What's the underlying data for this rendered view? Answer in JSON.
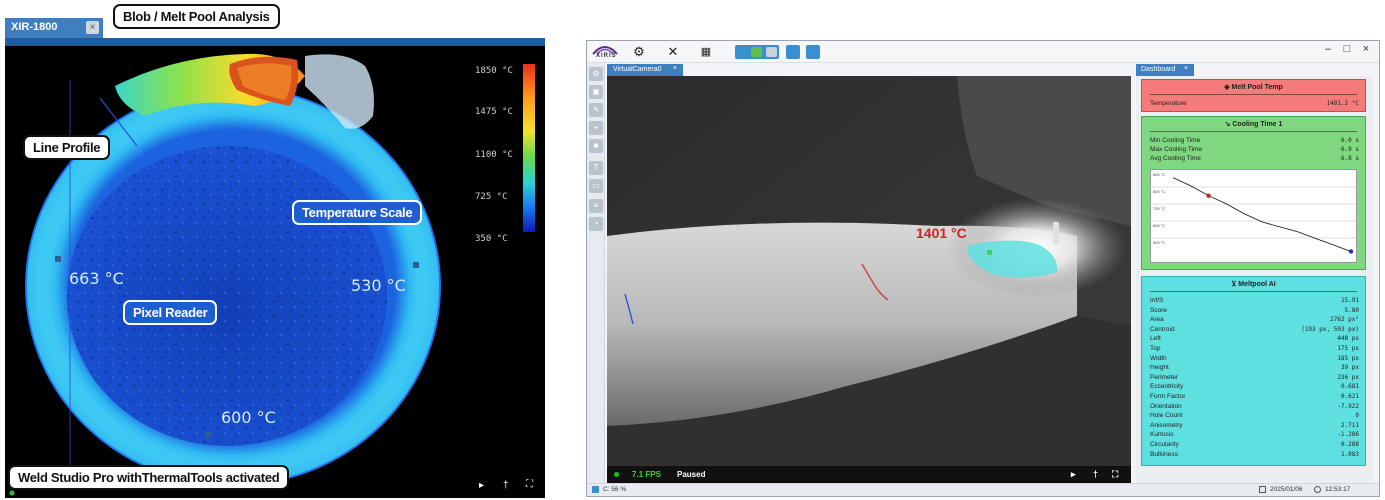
{
  "callouts": {
    "blob": "Blob / Melt Pool Analysis",
    "line_profile": "Line Profile",
    "temperature_scale": "Temperature Scale",
    "pixel_reader": "Pixel Reader",
    "weld_studio": "Weld Studio Pro withThermalTools activated"
  },
  "left": {
    "tab_title": "XIR-1800",
    "tab_close": "×",
    "readings": [
      "663 °C",
      "530 °C",
      "600 °C"
    ],
    "scale_ticks": [
      "1850 °C",
      "1475 °C",
      "1100 °C",
      "725 °C",
      "350 °C"
    ],
    "controls": {
      "play": "▸",
      "temp": "†",
      "fullscreen": "⛶"
    }
  },
  "right": {
    "logo_text": "XIRIS",
    "window_controls": [
      "–",
      "□",
      "×"
    ],
    "camera_tab": "VirtualCamera0",
    "camera_tab_close": "×",
    "melt_temp_label": "1401 °C",
    "fps": "7.1 FPS",
    "play_state": "Paused",
    "camera_controls": {
      "play": "▸",
      "temp": "†",
      "fullscreen": "⛶"
    },
    "dashboard_tab": "Dashboard",
    "dashboard_tab_close": "×",
    "melt_pool_temp": {
      "title": "Melt Pool Temp",
      "rows": [
        {
          "label": "Temperature",
          "value": "1401.2 °C"
        }
      ]
    },
    "cooling_time": {
      "title": "Cooling Time 1",
      "rows": [
        {
          "label": "Min Cooling Time",
          "value": "6.0 s"
        },
        {
          "label": "Max Cooling Time",
          "value": "6.9 s"
        },
        {
          "label": "Avg Cooling Time",
          "value": "6.8 s"
        }
      ],
      "y_ticks": [
        "800 °C",
        "600 °C",
        "700 °C",
        "600 °C",
        "500 °C"
      ],
      "curve": [
        0.02,
        0.12,
        0.24,
        0.34,
        0.46,
        0.56,
        0.62,
        0.68,
        0.76,
        0.84,
        0.92
      ]
    },
    "meltpool_ai": {
      "title": "Meltpool AI",
      "rows": [
        {
          "label": "Inf/S",
          "value": "15.91"
        },
        {
          "label": "Score",
          "value": "5.80"
        },
        {
          "label": "Area",
          "value": "2762 px²"
        },
        {
          "label": "Centroid",
          "value": "(193 px, 503 px)"
        },
        {
          "label": "Left",
          "value": "448 px"
        },
        {
          "label": "Top",
          "value": "175 px"
        },
        {
          "label": "Width",
          "value": "185 px"
        },
        {
          "label": "Height",
          "value": "39 px"
        },
        {
          "label": "Perimeter",
          "value": "236 px"
        },
        {
          "label": "Eccentricity",
          "value": "0.681"
        },
        {
          "label": "Form Factor",
          "value": "0.621"
        },
        {
          "label": "Orientation",
          "value": "-7.922"
        },
        {
          "label": "Hole Count",
          "value": "0"
        },
        {
          "label": "Anisometry",
          "value": "2.711"
        },
        {
          "label": "Kurtosis",
          "value": "-1.286"
        },
        {
          "label": "Circularity",
          "value": "0.288"
        },
        {
          "label": "Bulkiness",
          "value": "1.083"
        }
      ]
    },
    "status": {
      "zoom": "C: 56 %",
      "date": "2025/01/06",
      "time": "12:53:17"
    }
  },
  "colors": {
    "tab_blue": "#3f7fbf",
    "melt_red": "#f57a7a",
    "cooling_green": "#7fd87f",
    "ai_cyan": "#5fe0e0"
  }
}
